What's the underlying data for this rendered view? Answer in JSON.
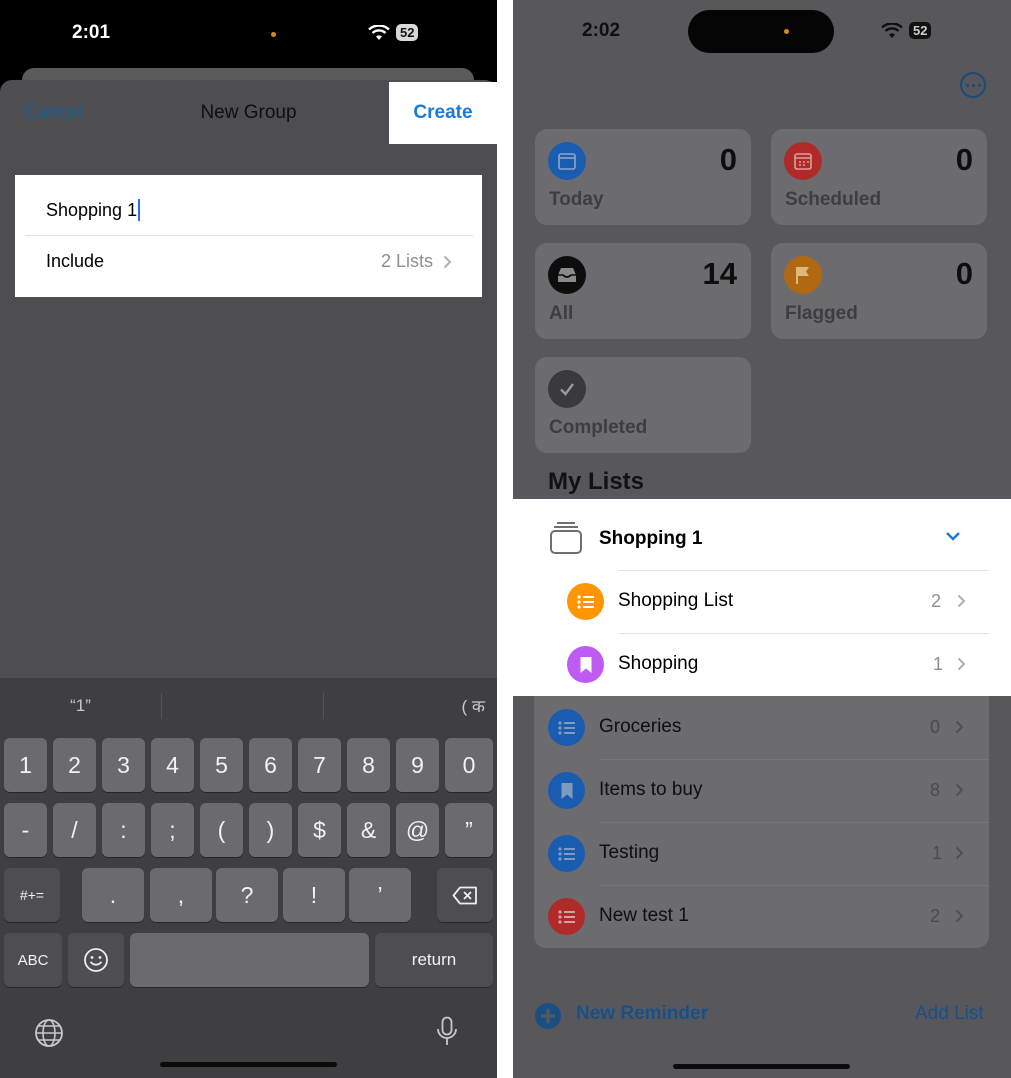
{
  "left": {
    "status": {
      "time": "2:01",
      "battery": "52"
    },
    "nav": {
      "cancel": "Cancel",
      "title": "New Group",
      "create": "Create"
    },
    "form": {
      "name_value": "Shopping 1",
      "include_label": "Include",
      "include_value": "2 Lists"
    },
    "keyboard": {
      "suggestions": [
        "“1”",
        "",
        "( क"
      ],
      "row1": [
        "1",
        "2",
        "3",
        "4",
        "5",
        "6",
        "7",
        "8",
        "9",
        "0"
      ],
      "row2": [
        "-",
        "/",
        ":",
        ";",
        "(",
        ")",
        "$",
        "&",
        "@",
        "”"
      ],
      "row3_left": "#+=",
      "row3": [
        ".",
        ",",
        "?",
        "!",
        "’"
      ],
      "abc": "ABC",
      "return": "return"
    }
  },
  "right": {
    "status": {
      "time": "2:02",
      "battery": "52"
    },
    "smart_lists": [
      {
        "label": "Today",
        "count": "0",
        "color": "#1a5cb0",
        "icon": "calendar-icon"
      },
      {
        "label": "Scheduled",
        "count": "0",
        "color": "#b02a2a",
        "icon": "scheduled-calendar-icon"
      },
      {
        "label": "All",
        "count": "14",
        "color": "#0d0d0d",
        "icon": "tray-icon"
      },
      {
        "label": "Flagged",
        "count": "0",
        "color": "#b06812",
        "icon": "flag-icon"
      },
      {
        "label": "Completed",
        "count": "",
        "color": "#3a3a3c",
        "icon": "checkmark-icon"
      }
    ],
    "section_title": "My Lists",
    "group": {
      "name": "Shopping 1",
      "lists": [
        {
          "label": "Shopping List",
          "count": "2",
          "color": "#ff9500",
          "icon": "list-bullet-icon"
        },
        {
          "label": "Shopping",
          "count": "1",
          "color": "#bf5af2",
          "icon": "bookmark-icon"
        }
      ]
    },
    "other_lists": [
      {
        "label": "Groceries",
        "count": "0",
        "color": "#1a5cb0",
        "icon": "list-bullet-icon"
      },
      {
        "label": "Items to buy",
        "count": "8",
        "color": "#1a5cb0",
        "icon": "bookmark-icon"
      },
      {
        "label": "Testing",
        "count": "1",
        "color": "#1a5cb0",
        "icon": "list-bullet-icon"
      },
      {
        "label": "New test 1",
        "count": "2",
        "color": "#b02a2a",
        "icon": "list-bullet-icon"
      }
    ],
    "bottom": {
      "new_reminder": "New Reminder",
      "add_list": "Add List"
    }
  }
}
